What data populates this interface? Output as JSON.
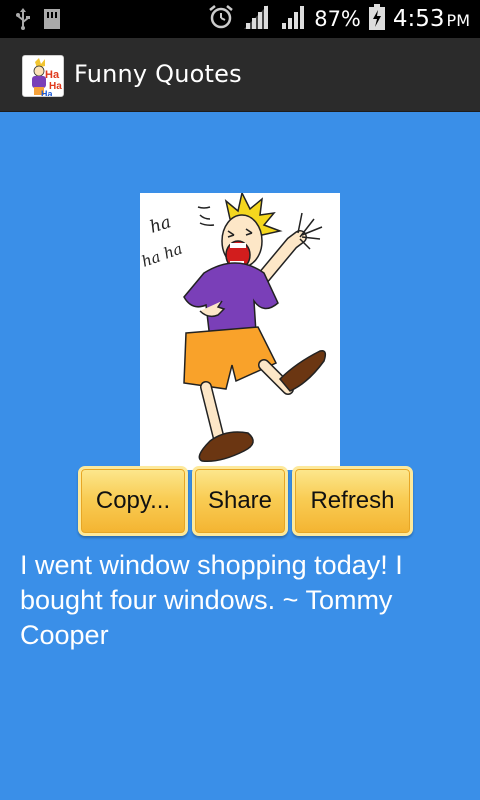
{
  "status_bar": {
    "battery_percent": "87%",
    "time": "4:53",
    "ampm": "PM",
    "icons": [
      "usb-icon",
      "sd-card-icon",
      "alarm-icon",
      "signal-icon",
      "signal-icon",
      "battery-charging-icon"
    ]
  },
  "action_bar": {
    "title": "Funny Quotes",
    "app_icon": "haha-app-icon"
  },
  "image": {
    "description_icon": "laughing-man-illustration",
    "caption_text": [
      "ha",
      "ha ha"
    ]
  },
  "buttons": {
    "copy": "Copy...",
    "share": "Share",
    "refresh": "Refresh"
  },
  "quote": {
    "text": "I went window shopping today! I bought four windows. ~ Tommy Cooper"
  },
  "colors": {
    "background": "#3a8fe8",
    "action_bar": "#2b2b2b",
    "button_gold": "#f9cd55"
  }
}
